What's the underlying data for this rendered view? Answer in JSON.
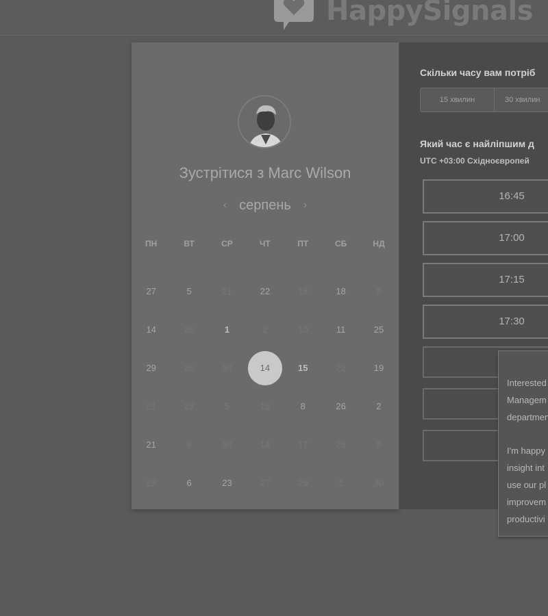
{
  "brand": {
    "name": "HappySignals"
  },
  "calendar": {
    "meet_title": "Зустрітися з Marc Wilson",
    "month": "серпень",
    "prev_icon": "chevron-left-icon",
    "next_icon": "chevron-right-icon",
    "weekdays": [
      "ПН",
      "ВТ",
      "СР",
      "ЧТ",
      "ПТ",
      "СБ",
      "НД"
    ],
    "weeks": [
      [
        {
          "d": "27",
          "s": "active"
        },
        {
          "d": "5",
          "s": "active"
        },
        {
          "d": "21",
          "s": "dim"
        },
        {
          "d": "22",
          "s": "active"
        },
        {
          "d": "18",
          "s": "dim"
        },
        {
          "d": "18",
          "s": "active"
        },
        {
          "d": "9",
          "s": "dim"
        }
      ],
      [
        {
          "d": "14",
          "s": "active"
        },
        {
          "d": "26",
          "s": "dim"
        },
        {
          "d": "1",
          "s": "bold"
        },
        {
          "d": "2",
          "s": "dim"
        },
        {
          "d": "10",
          "s": "dim"
        },
        {
          "d": "11",
          "s": "active"
        },
        {
          "d": "25",
          "s": "active"
        }
      ],
      [
        {
          "d": "29",
          "s": "active"
        },
        {
          "d": "25",
          "s": "dim"
        },
        {
          "d": "30",
          "s": "dim"
        },
        {
          "d": "14",
          "s": "sel"
        },
        {
          "d": "15",
          "s": "bold"
        },
        {
          "d": "22",
          "s": "dim"
        },
        {
          "d": "19",
          "s": "active"
        }
      ],
      [
        {
          "d": "21",
          "s": "dim"
        },
        {
          "d": "23",
          "s": "dim"
        },
        {
          "d": "5",
          "s": "dim"
        },
        {
          "d": "16",
          "s": "dim"
        },
        {
          "d": "8",
          "s": "active"
        },
        {
          "d": "26",
          "s": "active"
        },
        {
          "d": "2",
          "s": "active"
        }
      ],
      [
        {
          "d": "21",
          "s": "active"
        },
        {
          "d": "8",
          "s": "dim"
        },
        {
          "d": "30",
          "s": "dim"
        },
        {
          "d": "14",
          "s": "dim"
        },
        {
          "d": "17",
          "s": "dim"
        },
        {
          "d": "28",
          "s": "dim"
        },
        {
          "d": "9",
          "s": "dim"
        }
      ],
      [
        {
          "d": "28",
          "s": "dim"
        },
        {
          "d": "6",
          "s": "active"
        },
        {
          "d": "23",
          "s": "active"
        },
        {
          "d": "27",
          "s": "dim"
        },
        {
          "d": "29",
          "s": "dim"
        },
        {
          "d": "1",
          "s": "dim"
        },
        {
          "d": "30",
          "s": "dim"
        }
      ]
    ]
  },
  "booking": {
    "duration_question": "Скільки часу вам потріб",
    "durations": [
      "15 хвилин",
      "30 хвилин"
    ],
    "time_question": "Який час є найліпшим д",
    "timezone": "UTC +03:00 Східноєвропей",
    "slots": [
      "16:45",
      "17:00",
      "17:15",
      "17:30"
    ]
  },
  "bubble": {
    "para1": [
      "Interested",
      "Managem",
      "departmen"
    ],
    "para2": [
      "I'm happy",
      "insight int",
      "use our pl",
      "improvem",
      "productivi"
    ]
  }
}
